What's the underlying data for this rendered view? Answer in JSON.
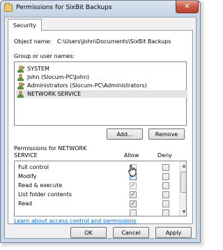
{
  "window": {
    "title": "Permissions for SixBit Backups",
    "close_glyph": "✕"
  },
  "tabs": [
    {
      "label": "Security"
    }
  ],
  "object": {
    "label": "Object name:",
    "value": "C:\\Users\\John\\Documents\\SixBit Backups"
  },
  "groups": {
    "label": "Group or user names:",
    "items": [
      {
        "label": "SYSTEM",
        "icon": "users-group-icon"
      },
      {
        "label": "John (Slocum-PC\\John)",
        "icon": "user-icon"
      },
      {
        "label": "Administrators (Slocum-PC\\Administrators)",
        "icon": "users-group-icon"
      },
      {
        "label": "NETWORK SERVICE",
        "icon": "user-icon",
        "selected": true
      }
    ]
  },
  "group_buttons": {
    "add_label": "Add...",
    "remove_label": "Remove"
  },
  "permissions": {
    "label_line1": "Permissions for NETWORK",
    "label_line2": "SERVICE",
    "allow_header": "Allow",
    "deny_header": "Deny",
    "check_glyph": "✓",
    "rows": [
      {
        "name": "Full control",
        "allow": false,
        "deny": false
      },
      {
        "name": "Modify",
        "allow": true,
        "deny": false
      },
      {
        "name": "Read & execute",
        "allow": true,
        "deny": false,
        "allow_inherited": true
      },
      {
        "name": "List folder contents",
        "allow": true,
        "deny": false
      },
      {
        "name": "Read",
        "allow": true,
        "deny": false
      },
      {
        "name": "",
        "allow": false,
        "deny": false
      }
    ]
  },
  "link": {
    "label": "Learn about access control and permissions"
  },
  "footer": {
    "ok_label": "OK",
    "cancel_label": "Cancel",
    "apply_label": "Apply"
  },
  "colors": {
    "accent": "#0066cc",
    "titlebar": "#c9d6e6",
    "close_button": "#c75b45"
  }
}
